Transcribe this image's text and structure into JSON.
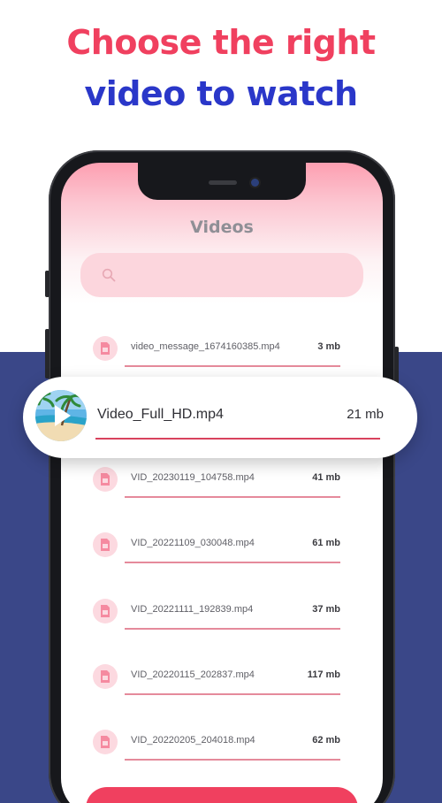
{
  "headline": {
    "line1": "Choose the right",
    "line2": "video to watch"
  },
  "colors": {
    "accent_pink": "#f0405f",
    "accent_blue": "#2a37c9",
    "band": "#3a4788"
  },
  "app": {
    "title": "Videos",
    "search": {
      "placeholder": "",
      "icon": "search-icon"
    }
  },
  "featured": {
    "name": "Video_Full_HD.mp4",
    "size": "21 mb",
    "icon": "play-icon"
  },
  "videos": [
    {
      "name": "video_message_1674160385.mp4",
      "size": "3 mb"
    },
    {
      "name": "VID_20230119_104758.mp4",
      "size": "41 mb"
    },
    {
      "name": "VID_20221109_030048.mp4",
      "size": "61 mb"
    },
    {
      "name": "VID_20221111_192839.mp4",
      "size": "37 mb"
    },
    {
      "name": "VID_20220115_202837.mp4",
      "size": "117 mb"
    },
    {
      "name": "VID_20220205_204018.mp4",
      "size": "62 mb"
    }
  ]
}
